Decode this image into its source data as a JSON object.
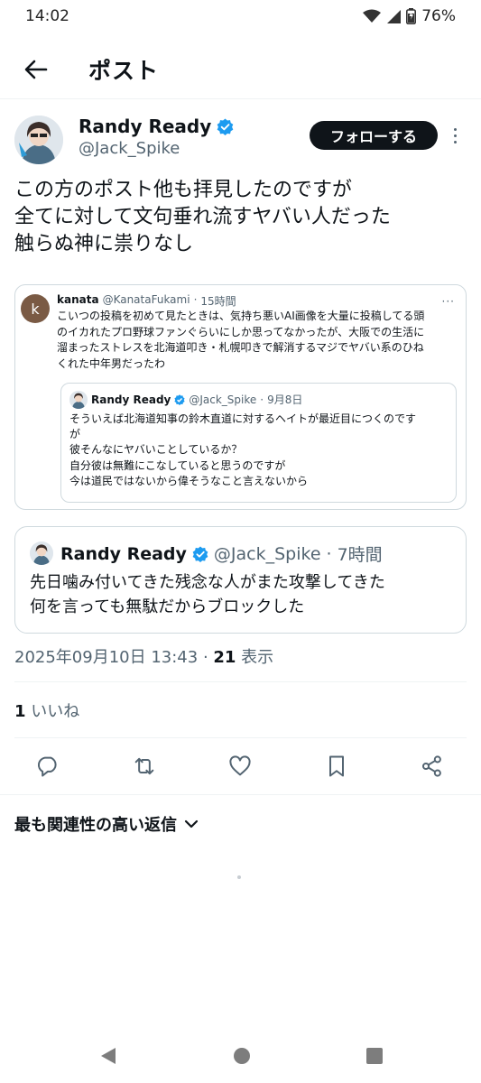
{
  "status_bar": {
    "time": "14:02",
    "battery": "76%"
  },
  "header": {
    "title": "ポスト"
  },
  "post": {
    "author_name": "Randy Ready",
    "author_handle": "@Jack_Spike",
    "follow_label": "フォローする",
    "text_lines": [
      "この方のポスト他も拝見したのですが",
      "全てに対して文句垂れ流すヤバい人だった",
      "触らぬ神に祟りなし"
    ]
  },
  "quoted_screenshot": {
    "avatar_letter": "k",
    "author_name": "kanata",
    "author_handle": "@KanataFukami",
    "separator": "·",
    "time": "15時間",
    "more": "···",
    "text_lines": [
      "こいつの投稿を初めて見たときは、気持ち悪いAI画像を大量に投稿してる頭",
      "のイカれたプロ野球ファンぐらいにしか思ってなかったが、大阪での生活に",
      "溜まったストレスを北海道叩き・札幌叩きで解消するマジでヤバい系のひね",
      "くれた中年男だったわ"
    ],
    "inner": {
      "author_name": "Randy Ready",
      "author_handle": "@Jack_Spike",
      "separator": "·",
      "time": "9月8日",
      "text_lines": [
        "そういえば北海道知事の鈴木直道に対するヘイトが最近目につくのです",
        "が",
        "彼そんなにヤバいことしているか？",
        "自分彼は無難にこなしていると思うのですが",
        "今は道民ではないから偉そうなこと言えないから"
      ]
    }
  },
  "quoted_post": {
    "author_name": "Randy Ready",
    "author_handle": "@Jack_Spike",
    "separator": "·",
    "time": "7時間",
    "text_lines": [
      "先日噛み付いてきた残念な人がまた攻撃してきた",
      "何を言っても無駄だからブロックした"
    ]
  },
  "meta": {
    "timestamp": "2025年09月10日 13:43",
    "separator": " · ",
    "views_count": "21",
    "views_label": " 表示"
  },
  "likes": {
    "count": "1",
    "label": " いいね"
  },
  "actions": [
    "reply-icon",
    "repost-icon",
    "like-icon",
    "bookmark-icon",
    "share-icon"
  ],
  "replies": {
    "sort_label": "最も関連性の高い返信"
  },
  "colors": {
    "verified": "#1d9bf0",
    "text": "#0f1419",
    "secondary": "#536471",
    "border": "#cfd9de"
  }
}
